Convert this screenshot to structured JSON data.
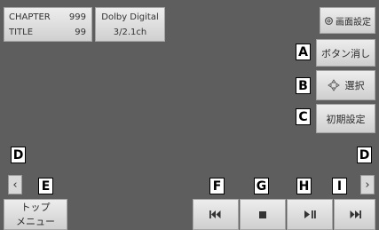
{
  "info": {
    "chapter_label": "CHAPTER",
    "chapter_value": "999",
    "title_label": "TITLE",
    "title_value": "99",
    "audio_format": "Dolby Digital",
    "audio_channels": "3/2.1ch"
  },
  "screen_settings": {
    "label": "画面設定",
    "icon": "gear-icon"
  },
  "buttons": {
    "hide": "ボタン消し",
    "select": "選択",
    "initial_settings": "初期設定",
    "top_menu_line1": "トップ",
    "top_menu_line2": "メニュー"
  },
  "playback": {
    "prev_icon": "previous-chapter-icon",
    "stop_icon": "stop-icon",
    "play_pause_icon": "play-pause-icon",
    "next_icon": "next-chapter-icon"
  },
  "tags": {
    "A": "A",
    "B": "B",
    "C": "C",
    "D": "D",
    "E": "E",
    "F": "F",
    "G": "G",
    "H": "H",
    "I": "I"
  },
  "arrows": {
    "left": "‹",
    "right": "›"
  },
  "colors": {
    "screen": "#5e5e5e",
    "button": "#e2e2e2"
  }
}
